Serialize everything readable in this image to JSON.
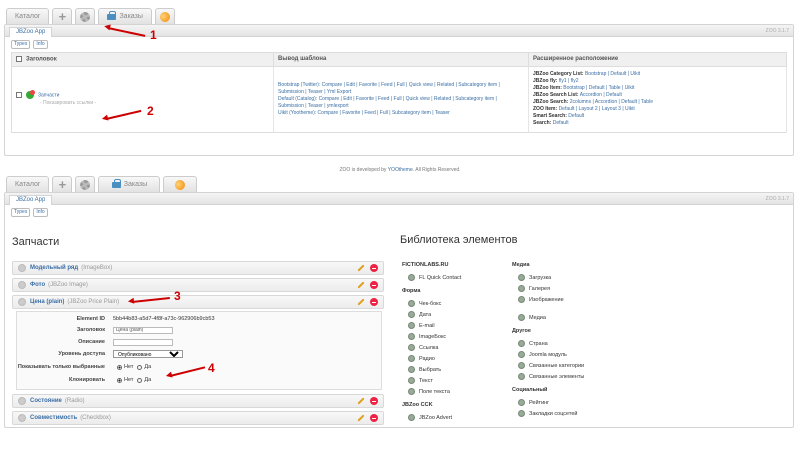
{
  "top": {
    "tabs": {
      "catalog": "Каталог",
      "orders": "Заказы"
    },
    "app_tab": "JBZoo App",
    "version": "ZOO 3.1.7",
    "buttons": {
      "types": "Types",
      "info": "Info"
    },
    "table": {
      "headers": [
        "Заголовок",
        "Вывод шаблона",
        "Расширенное расположение"
      ],
      "row": {
        "title": "Запчасти",
        "subtitle": "- Показ​ировать ссылки -",
        "templates": [
          "Bootstrap (Twitter): Compare | Edit | Favorite | Feed | Full | Quick view | Related | Subcategory item | Submission | Teaser | Yml Export",
          "Default (Catalog): Compare | Edit | Favorite | Feed | Full | Quick view | Related | Subcategory item | Submission | Teaser | ymlexport",
          "Uikit (Yootheme): Compare | Favorite | Feed | Full | Subcategory item | Teaser"
        ],
        "layouts": [
          {
            "k": "JBZoo Category List:",
            "v": "Bootstrap | Default | Uikit"
          },
          {
            "k": "JBZoo fly:",
            "v": "fly1 | fly2"
          },
          {
            "k": "JBZoo Item:",
            "v": "Bootstrap | Default | Table | Uikit"
          },
          {
            "k": "JBZoo Search List:",
            "v": "Accordion | Default"
          },
          {
            "k": "JBZoo Search:",
            "v": "2columns | Accordion | Default | Table"
          },
          {
            "k": "ZOO Item:",
            "v": "Default | Layout 2 | Layout 3 | Uikit"
          },
          {
            "k": "Smart Search:",
            "v": "Default"
          },
          {
            "k": "Search:",
            "v": "Default"
          }
        ]
      }
    }
  },
  "footer": {
    "before": "ZOO is developed by ",
    "link": "YOOtheme",
    "after": ". All Rights Reserved."
  },
  "bottom": {
    "tabs": {
      "catalog": "Каталог",
      "orders": "Заказы"
    },
    "app_tab": "JBZoo App",
    "version": "ZOO 3.1.7",
    "buttons": {
      "types": "Types",
      "info": "Info"
    },
    "section_title": "Запчасти",
    "library_title": "Библиотека элементов",
    "elements": [
      {
        "name": "Модельный ряд",
        "type": "(ImageBox)"
      },
      {
        "name": "Фото",
        "type": "(JBZoo Image)"
      },
      {
        "name": "Цена (plain)",
        "type": "(JBZoo Price Plain)"
      },
      {
        "name": "Состояние",
        "type": "(Radio)"
      },
      {
        "name": "Совместимость",
        "type": "(Checkbox)"
      }
    ],
    "form": {
      "element_id_label": "Element ID",
      "element_id": "5bb44b83-a5d7-4f8f-a73c-962906b9cb53",
      "title_label": "Заголовок",
      "title_value": "Цена (plain)",
      "desc_label": "Описание",
      "access_label": "Уровень доступа",
      "access_value": "Опубликовано",
      "show_selected_label": "Показывать только выбранные",
      "clone_label": "Клонировать",
      "no": "Нет",
      "yes": "Да"
    },
    "library": {
      "col1": [
        {
          "header": "FICTIONLABS.RU",
          "items": [
            "FL Quick Contact"
          ]
        },
        {
          "header": "Форма",
          "items": [
            "Чек-бокс",
            "Дата",
            "E-mail",
            "ImageБокс",
            "Ссылка",
            "Радио",
            "Выбрать",
            "Текст",
            "Поле текста"
          ]
        },
        {
          "header": "JBZoo CCK",
          "items": [
            "JBZoo Advert"
          ]
        }
      ],
      "col2": [
        {
          "header": "Медиа",
          "items": [
            "Загрузка",
            "Галерея",
            "Изображение",
            "Медиа"
          ]
        },
        {
          "header": "Другое",
          "items": [
            "Страна",
            "Joomla модуль",
            "Связанные категории",
            "Связанные элементы"
          ]
        },
        {
          "header": "Социальный",
          "items": [
            "Рейтинг",
            "Закладки соцсетей"
          ]
        }
      ]
    }
  },
  "annotations": {
    "n1": "1",
    "n2": "2",
    "n3": "3",
    "n4": "4"
  },
  "colors": {
    "link": "#3a6ea5",
    "annotation": "#cc0000",
    "delete": "#e22244",
    "edit": "#e0a020"
  }
}
